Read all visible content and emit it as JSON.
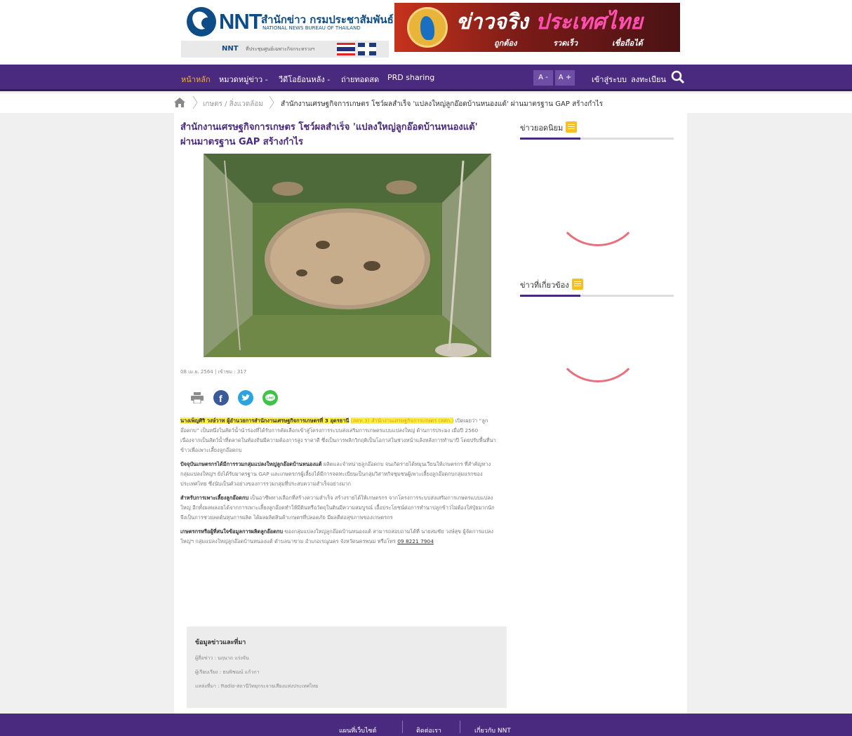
{
  "logo": {
    "nnt": "NNT",
    "title_th": "สำนักข่าว กรมประชาสัมพันธ์",
    "title_en": "NATIONAL NEWS BUREAU OF THAILAND",
    "strip_nnt": "NNT",
    "strip_text": "ที่ประชุมศูนย์เฉพาะกิจกระทรวงฯ"
  },
  "banner": {
    "title_part1": "ข่าวจริง",
    "title_part2": "ประเทศไทย",
    "tags": [
      "ถูกต้อง",
      "รวดเร็ว",
      "เชื่อถือได้"
    ]
  },
  "nav": {
    "items": [
      "หน้าหลัก",
      "หมวดหมู่ข่าว -",
      "วีดีโอย้อนหลัง -",
      "ถ่ายทอดสด",
      "PRD sharing"
    ],
    "font_minus": "A -",
    "font_plus": "A +",
    "login": "เข้าสู่ระบบ",
    "register": "ลงทะเบียน"
  },
  "breadcrumb": {
    "category": "เกษตร / สิ่งแวดล้อม",
    "current": "สำนักงานเศรษฐกิจการเกษตร โชว์ผลสำเร็จ 'แปลงใหญ่ลูกอ๊อดบ้านหนองแต้' ผ่านมาตรฐาน GAP สร้างกำไร"
  },
  "article": {
    "title": "สำนักงานเศรษฐกิจการเกษตร โชว์ผลสำเร็จ 'แปลงใหญ่ลูกอ๊อดบ้านหนองแต้' ผ่านมาตรฐาน GAP สร้างกำไร",
    "meta": "08 เม.ย. 2564 | เข้าชม : 317",
    "p1_bold": "นางเพ็ญศิริ วงษ์วาท ผู้อำนวยการสำนักงานเศรษฐกิจการเกษตรที่ 3 อุดรธานี",
    "p1_link": "(สศท.3) สำนักงานเศรษฐกิจการเกษตร (สศก.)",
    "p1_text": " เปิดเผยว่า “ลูกอ๊อดกบ” เป็นหนึ่งในสัตว์น้ำนำร่องที่ได้รับการคัดเลือกเข้าสู่โครงการระบบส่งเสริมการเกษตรแบบแปลงใหญ่ ด้านการประมง เมื่อปี 2560 เนื่องจากเป็นสัตว์น้ำที่ตลาดในท้องถิ่นมีความต้องการสูง ราคาดี ซึ่งเป็นการพลิกวิกฤติเป็นโอกาสในช่วงหน้าแล้งหลังการทำนาปี โดยปรับพื้นที่นาข้าวเพื่อเพาะเลี้ยงลูกอ๊อดกบ",
    "p2_bold": "ปัจจุบันเกษตรกรได้มีการรวมกลุ่มแปลงใหญ่ลูกอ๊อดบ้านหนองแต้",
    "p2_text": " ผลิตและจำหน่ายลูกอ๊อดกบ จนเกิดรายได้หมุนเวียนให้เกษตรกร ที่สำคัญทางกลุ่มแปลงใหญ่ฯ ยังได้รับมาตรฐาน GAP และเกษตรกรผู้เลี้ยงได้มีการจดทะเบียนเป็นกลุ่มวิสาหกิจชุมชนผู้เพาะเลี้ยงลูกอ๊อดกบกลุ่มแรกของประเทศไทย ซึ่งนับเป็นตัวอย่างของการรวมกลุ่มที่ประสบความสำเร็จอย่างมาก",
    "p3_bold": "สำหรับการเพาะเลี้ยงลูกอ๊อดกบ",
    "p3_text": " เป็นอาชีพทางเลือกที่สร้างความสำเร็จ สร้างรายได้ให้เกษตรกร จากโครงการระบบส่งเสริมการเกษตรแบบแปลงใหญ่ อีกทั้งผลพลอยได้จากการเพาะเลี้ยงลูกอ๊อดทำให้มีดินหรือวัตถุในดินมีความสมบูรณ์ เอื้อประโยชน์ต่อการทำนาปลูกข้าวไม่ต้องใส่ปุ๋ยมากนัก จึงเป็นการช่วยลดต้นทุนการผลิต ได้ผลผลิตสินค้าเกษตรที่ปลอดภัย มีผลดีต่อสุขภาพของเกษตรกร",
    "p4_bold": "เกษตรกรหรือผู้ที่สนใจข้อมูลการผลิตลูกอ๊อดกบ",
    "p4_text": " ของกลุ่มแปลงใหญ่ลูกอ๊อดบ้านหนองแต้ สามารถสอบถามได้ที่ นายสมชัย วงษ์สุข ผู้จัดการแปลงใหญ่ฯ กลุ่มแปลงใหญ่ลูกอ๊อดบ้านหนองแต้ ตำบลนาขาม อำเภอเรณูนคร จังหวัดนครพนม หรือโทร ",
    "p4_phone": "09 8221 7904"
  },
  "source": {
    "title": "ข้อมูลข่าวและที่มา",
    "reporter": "ผู้สื่อข่าว : นฤนาถ แร่งจัน",
    "editor": "ผู้เรียบเรียง : ธนพิชฌน์ แก้วกา",
    "origin": "แหล่งที่มา : Radio-สถานีวิทยุกระจายเสียงแห่งประเทศไทย"
  },
  "sidebar": {
    "popular": "ข่าวยอดนิยม",
    "related": "ข่าวที่เกี่ยวข้อง"
  },
  "footer": {
    "links": [
      "แผนที่เว็บไซต์",
      "ติดต่อเรา",
      "เกี่ยวกับ NNT"
    ]
  },
  "colors": {
    "nav_bg": "#4a2a7e",
    "active_nav": "#f5b325",
    "highlight": "#fff23d",
    "accent_link": "#e59a2a"
  }
}
